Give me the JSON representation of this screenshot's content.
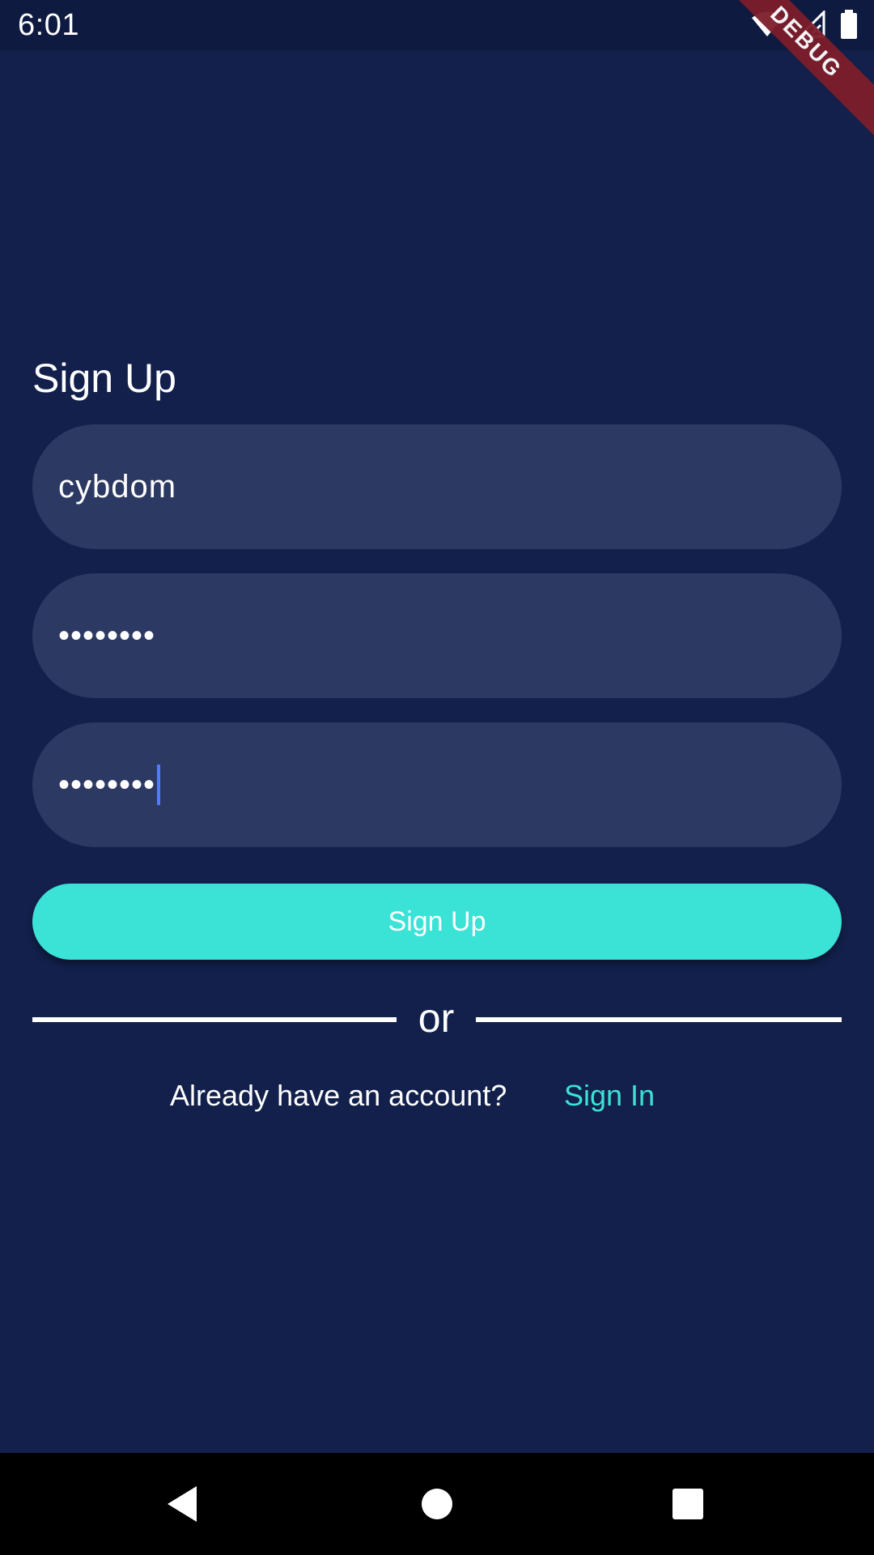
{
  "status_bar": {
    "time": "6:01",
    "icons": [
      "wifi-icon",
      "signal-icon",
      "battery-icon"
    ],
    "debug_banner": "DEBUG"
  },
  "main": {
    "title": "Sign Up",
    "fields": [
      {
        "value": "cybdom",
        "type": "text"
      },
      {
        "value": "••••••••",
        "type": "password"
      },
      {
        "value": "••••••••",
        "type": "password",
        "focused": true
      }
    ],
    "signup_button_label": "Sign Up",
    "divider_text": "or",
    "account_prompt": "Already have an account?",
    "signin_link": "Sign In"
  },
  "nav_bar": {
    "buttons": [
      "back-icon",
      "home-icon",
      "recents-icon"
    ]
  },
  "colors": {
    "background": "#12204b",
    "field_background": "#2c3963",
    "accent": "#3be2d6",
    "cursor": "#4f7df5",
    "debug_ribbon": "#7d1d2a"
  }
}
